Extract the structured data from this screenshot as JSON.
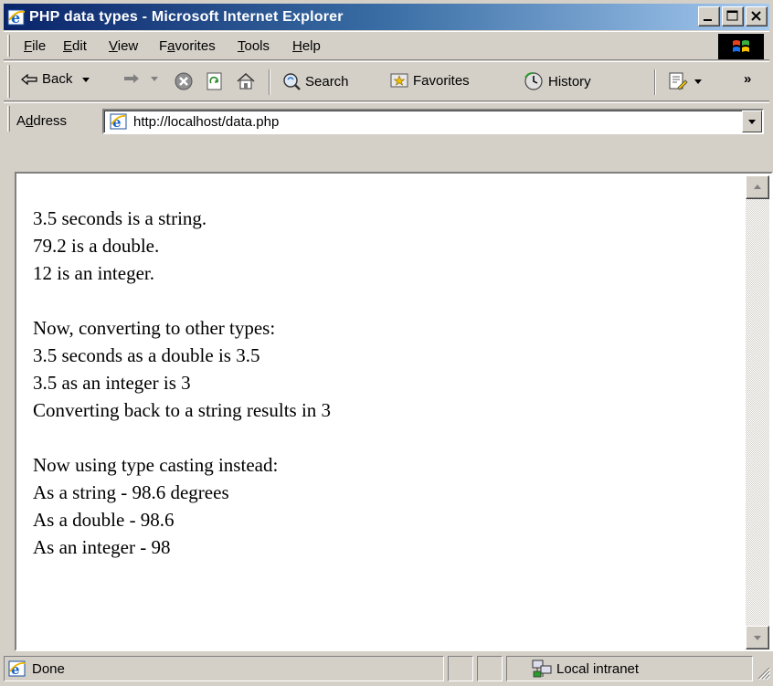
{
  "window": {
    "title": "PHP data types - Microsoft Internet Explorer"
  },
  "menu": {
    "items": [
      {
        "pre": "",
        "key": "F",
        "post": "ile"
      },
      {
        "pre": "",
        "key": "E",
        "post": "dit"
      },
      {
        "pre": "",
        "key": "V",
        "post": "iew"
      },
      {
        "pre": "F",
        "key": "a",
        "post": "vorites"
      },
      {
        "pre": "",
        "key": "T",
        "post": "ools"
      },
      {
        "pre": "",
        "key": "H",
        "post": "elp"
      }
    ]
  },
  "toolbar": {
    "back_label": "Back",
    "search_label": "Search",
    "favorites_label": "Favorites",
    "history_label": "History",
    "chevron": "»"
  },
  "address": {
    "label_pre": "A",
    "label_key": "d",
    "label_post": "dress",
    "url": "http://localhost/data.php"
  },
  "content": {
    "lines": [
      "3.5 seconds is a string.",
      "79.2 is a double.",
      "12 is an integer.",
      "",
      "Now, converting to other types:",
      "3.5 seconds as a double is 3.5",
      "3.5 as an integer is 3",
      "Converting back to a string results in 3",
      "",
      "Now using type casting instead:",
      "As a string - 98.6 degrees",
      "As a double - 98.6",
      "As an integer - 98"
    ]
  },
  "status": {
    "text": "Done",
    "zone": "Local intranet"
  },
  "colors": {
    "title_bar": "#0a246a",
    "chrome": "#d4d0c8"
  }
}
